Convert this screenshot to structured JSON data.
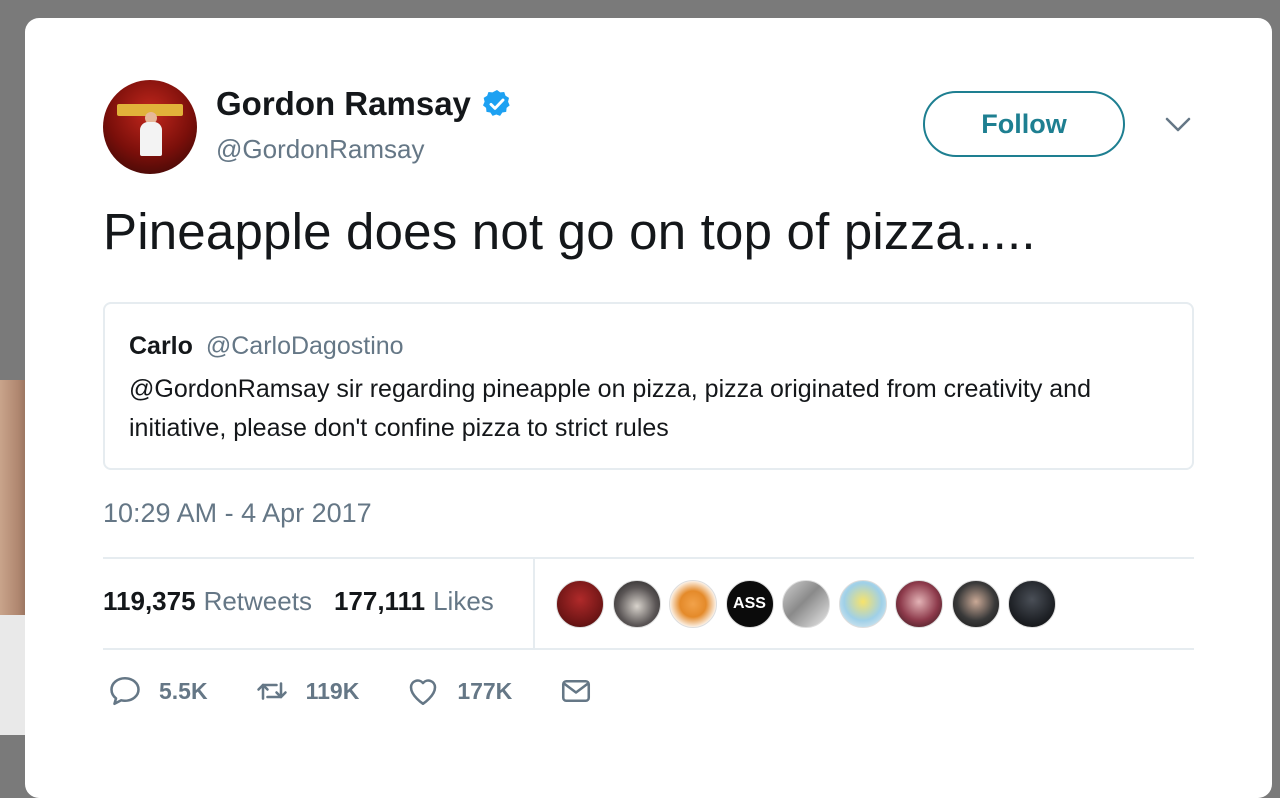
{
  "author": {
    "name": "Gordon Ramsay",
    "handle": "@GordonRamsay",
    "verified": true
  },
  "follow_label": "Follow",
  "tweet_text": "Pineapple does not go on top of pizza.....",
  "quoted": {
    "name": "Carlo",
    "handle": "@CarloDagostino",
    "text": "@GordonRamsay sir regarding  pineapple on pizza, pizza originated from creativity and initiative, please don't confine pizza to strict rules"
  },
  "timestamp": "10:29 AM - 4 Apr 2017",
  "stats": {
    "retweets_count": "119,375",
    "retweets_label": "Retweets",
    "likes_count": "177,111",
    "likes_label": "Likes"
  },
  "likers": [
    {
      "kind": "avatar-red-character",
      "text": ""
    },
    {
      "kind": "avatar-dark-hair",
      "text": ""
    },
    {
      "kind": "avatar-orange-cat",
      "text": ""
    },
    {
      "kind": "avatar-text-logo",
      "text": "ASS"
    },
    {
      "kind": "avatar-room-photo",
      "text": ""
    },
    {
      "kind": "avatar-yellow-cartoon",
      "text": ""
    },
    {
      "kind": "avatar-pink-portrait",
      "text": ""
    },
    {
      "kind": "avatar-dark-portrait",
      "text": ""
    },
    {
      "kind": "avatar-black-silhouette",
      "text": ""
    }
  ],
  "actions": {
    "reply": "5.5K",
    "retweet": "119K",
    "like": "177K"
  },
  "colors": {
    "follow_accent": "#1e7f91",
    "verified_blue": "#1da1f2",
    "secondary_text": "#657786"
  }
}
